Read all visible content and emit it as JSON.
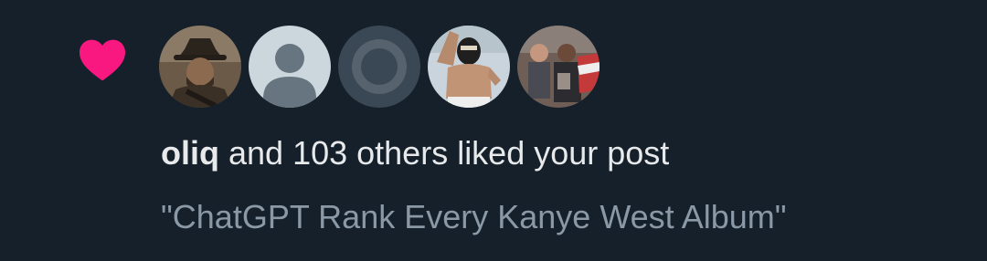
{
  "notification": {
    "icon": "heart-icon",
    "icon_color": "#f91880",
    "avatars": [
      {
        "kind": "photo-cowboy"
      },
      {
        "kind": "default-avatar"
      },
      {
        "kind": "symbol-emblem"
      },
      {
        "kind": "photo-masked-wrestler"
      },
      {
        "kind": "photo-crowd"
      }
    ],
    "user": "oliq",
    "summary_rest": "and 103 others liked your post",
    "post_preview": "\"ChatGPT Rank Every Kanye West Album\""
  },
  "colors": {
    "background": "#15202b",
    "text_primary": "#e7e9ea",
    "text_secondary": "#8b98a5",
    "accent": "#f91880"
  }
}
